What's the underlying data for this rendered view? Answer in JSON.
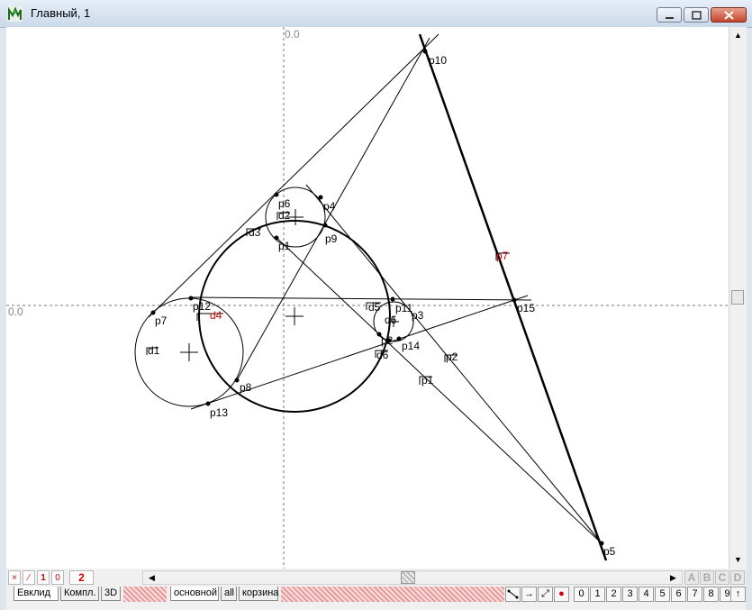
{
  "window": {
    "title": "Главный, 1"
  },
  "canvas": {
    "axis_origin_label_x": "0.0",
    "axis_origin_label_y": "0.0",
    "labels": [
      "p10",
      "p6",
      "d2",
      "p4",
      "p1",
      "p9",
      "d3",
      "p7",
      "p12",
      "d4",
      "p11",
      "p3",
      "p15",
      "p7",
      "d5",
      "d6",
      "p14",
      "p2",
      "d1",
      "d6",
      "p8",
      "p13",
      "p1",
      "p2",
      "p5"
    ]
  },
  "bottom_toolbar": {
    "tools": [
      "×",
      "⁄",
      "1",
      "0"
    ],
    "zoom_value": "2",
    "letters": [
      "A",
      "B",
      "C",
      "D"
    ]
  },
  "mode_tabs": [
    "Евклид",
    "Компл.",
    "3D"
  ],
  "layer_tabs": [
    "основной",
    "all",
    "корзина"
  ],
  "number_buttons": [
    "0",
    "1",
    "2",
    "3",
    "4",
    "5",
    "6",
    "7",
    "8",
    "9",
    "↑"
  ],
  "colors": {
    "accent_red": "#d00000",
    "hatch_pink": "#e69a9a"
  }
}
